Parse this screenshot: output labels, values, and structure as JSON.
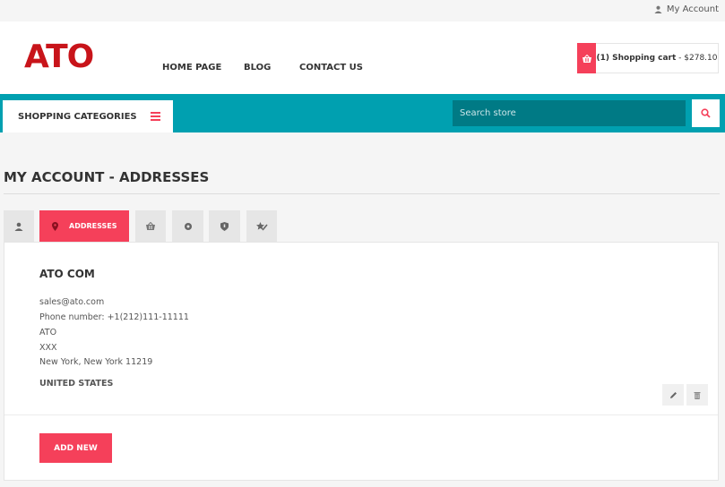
{
  "topbar": {
    "my_account": "My Account",
    "icon": "user-icon"
  },
  "header": {
    "logo": "ATO",
    "nav": [
      {
        "label": "HOME PAGE"
      },
      {
        "label": "BLOG"
      },
      {
        "label": "CONTACT US"
      }
    ],
    "cart": {
      "count_label": "(1) Shopping cart",
      "separator": " - ",
      "total": "$278.10",
      "icon": "basket-icon"
    }
  },
  "menubar": {
    "categories_label": "SHOPPING CATEGORIES",
    "search_placeholder": "Search store",
    "search_icon": "search-icon"
  },
  "page": {
    "title": "MY ACCOUNT - ADDRESSES",
    "tabs": [
      {
        "icon": "user-icon",
        "label": ""
      },
      {
        "icon": "map-pin-icon",
        "label": "ADDRESSES",
        "active": true
      },
      {
        "icon": "basket-icon",
        "label": ""
      },
      {
        "icon": "gear-icon",
        "label": ""
      },
      {
        "icon": "shield-icon",
        "label": ""
      },
      {
        "icon": "star-edit-icon",
        "label": ""
      }
    ],
    "address": {
      "name": "ATO COM",
      "email": "sales@ato.com",
      "phone": "Phone number: +1(212)111-11111",
      "company": "ATO",
      "street": "XXX",
      "city_line": "New York, New York 11219",
      "country": "UNITED STATES"
    },
    "add_new_label": "ADD NEW"
  },
  "colors": {
    "accent": "#f5405a",
    "teal": "#00a0b0",
    "logo": "#c8141a"
  }
}
